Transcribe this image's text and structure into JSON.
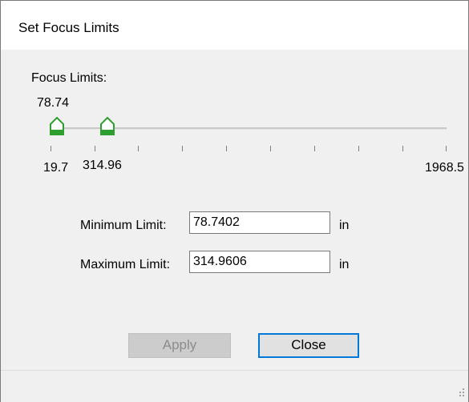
{
  "window": {
    "title": "Set Focus Limits"
  },
  "slider": {
    "group_label": "Focus Limits:",
    "min_value_label": "19.7",
    "max_value_label": "1968.5",
    "lower_thumb_value": "78.74",
    "upper_thumb_value": "314.96",
    "range_min": 19.7,
    "range_max": 1968.5,
    "lower_value": 78.74,
    "upper_value": 314.96,
    "thumb_color": "#2e9e2e"
  },
  "fields": {
    "minimum": {
      "label": "Minimum Limit:",
      "value": "78.7402",
      "unit": "in"
    },
    "maximum": {
      "label": "Maximum Limit:",
      "value": "314.9606",
      "unit": "in"
    }
  },
  "buttons": {
    "apply_label": "Apply",
    "close_label": "Close"
  },
  "colors": {
    "focus_border": "#0078d7",
    "disabled_text": "#8c8c8c"
  }
}
